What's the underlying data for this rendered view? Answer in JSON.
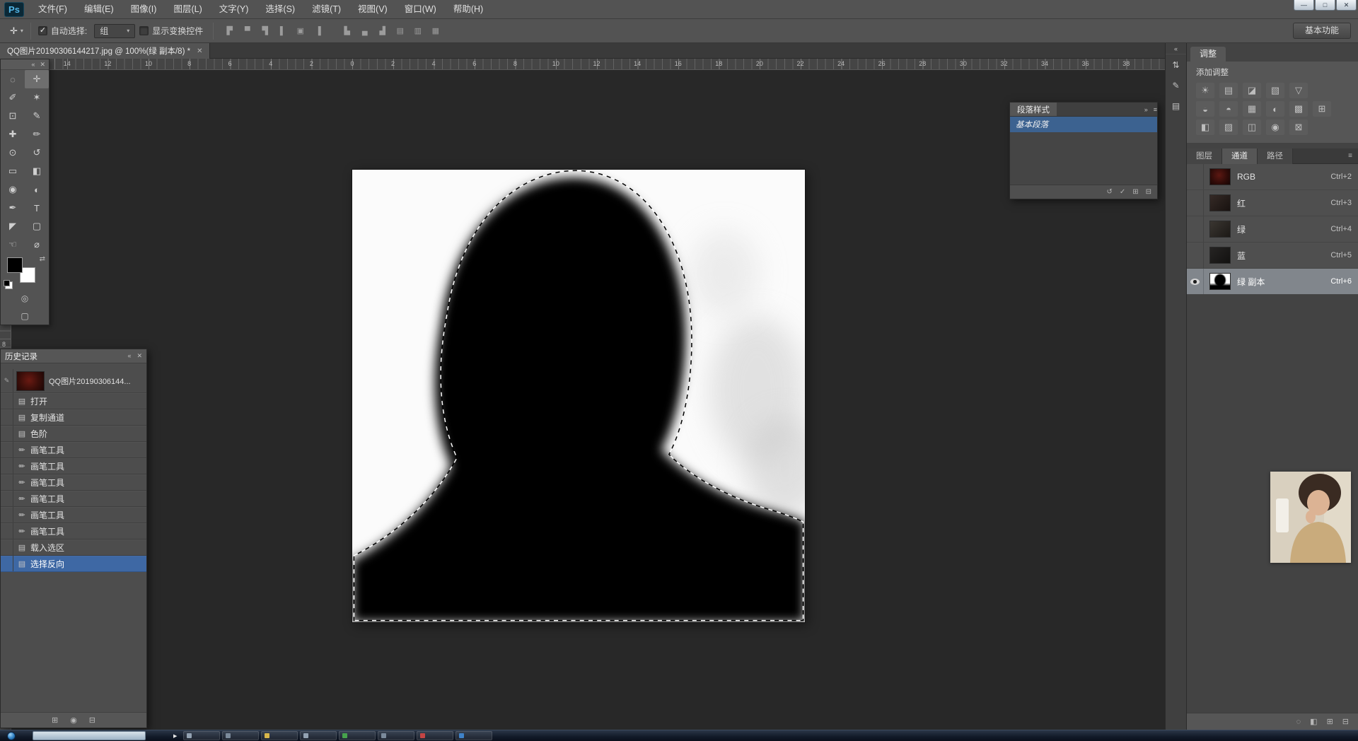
{
  "window": {
    "app": "Ps",
    "controls": [
      {
        "name": "minimize-button",
        "glyph": "—"
      },
      {
        "name": "maximize-button",
        "glyph": "□"
      },
      {
        "name": "close-button",
        "glyph": "✕"
      }
    ]
  },
  "menu_bar": {
    "items": [
      "文件(F)",
      "编辑(E)",
      "图像(I)",
      "图层(L)",
      "文字(Y)",
      "选择(S)",
      "滤镜(T)",
      "视图(V)",
      "窗口(W)",
      "帮助(H)"
    ]
  },
  "options_bar": {
    "tool_glyph": "✛",
    "tool_dropdown_arrow": "▾",
    "auto_select_label": "自动选择:",
    "auto_select_checked": true,
    "group_value": "组",
    "group_arrow": "▾",
    "show_transform_label": "显示变换控件",
    "show_transform_checked": false,
    "align_icons": [
      {
        "name": "align-top-edges-icon",
        "glyph": "▛"
      },
      {
        "name": "align-vertical-centers-icon",
        "glyph": "▀"
      },
      {
        "name": "align-bottom-edges-icon",
        "glyph": "▜"
      },
      {
        "name": "align-left-edges-icon",
        "glyph": "▌"
      },
      {
        "name": "align-horizontal-centers-icon",
        "glyph": "▣"
      },
      {
        "name": "align-right-edges-icon",
        "glyph": "▐"
      },
      {
        "name": "distribute-top-edges-icon",
        "glyph": "▙"
      },
      {
        "name": "distribute-vertical-centers-icon",
        "glyph": "▄"
      },
      {
        "name": "distribute-bottom-edges-icon",
        "glyph": "▟"
      },
      {
        "name": "distribute-left-edges-icon",
        "glyph": "▤"
      },
      {
        "name": "distribute-horizontal-centers-icon",
        "glyph": "▥"
      },
      {
        "name": "distribute-right-edges-icon",
        "glyph": "▦"
      }
    ],
    "workspace_label": "基本功能"
  },
  "document_tab": {
    "title": "QQ图片20190306144217.jpg @ 100%(绿 副本/8) *",
    "close_glyph": "✕"
  },
  "rulers": {
    "h_labels": [
      "14",
      "12",
      "10",
      "8",
      "6",
      "4",
      "2",
      "0",
      "2",
      "4",
      "6",
      "8",
      "10",
      "12",
      "14",
      "16",
      "18",
      "20",
      "22",
      "24",
      "26",
      "28",
      "30",
      "32",
      "34",
      "36",
      "38"
    ],
    "v_label": "8"
  },
  "tools_panel": {
    "collapse_glyph": "«",
    "close_glyph": "✕",
    "tools": [
      {
        "name": "elliptical-marquee-tool",
        "glyph": "◌"
      },
      {
        "name": "move-tool",
        "glyph": "✛",
        "selected": true
      },
      {
        "name": "lasso-tool",
        "glyph": "✐"
      },
      {
        "name": "magic-wand-tool",
        "glyph": "✶"
      },
      {
        "name": "crop-tool",
        "glyph": "⊡"
      },
      {
        "name": "eyedropper-tool",
        "glyph": "✎"
      },
      {
        "name": "healing-brush-tool",
        "glyph": "✚"
      },
      {
        "name": "brush-tool",
        "glyph": "✏"
      },
      {
        "name": "clone-stamp-tool",
        "glyph": "⊙"
      },
      {
        "name": "history-brush-tool",
        "glyph": "↺"
      },
      {
        "name": "eraser-tool",
        "glyph": "▭"
      },
      {
        "name": "gradient-tool",
        "glyph": "◧"
      },
      {
        "name": "blur-tool",
        "glyph": "◉"
      },
      {
        "name": "dodge-tool",
        "glyph": "◐"
      },
      {
        "name": "pen-tool",
        "glyph": "✒"
      },
      {
        "name": "type-tool",
        "glyph": "T"
      },
      {
        "name": "path-selection-tool",
        "glyph": "◤"
      },
      {
        "name": "rectangle-tool",
        "glyph": "▢"
      },
      {
        "name": "hand-tool",
        "glyph": "☜"
      },
      {
        "name": "zoom-tool",
        "glyph": "⌀"
      }
    ],
    "quick_mask_glyph": "◎",
    "screen_mode_glyph": "▢",
    "swap_glyph": "⇄"
  },
  "history_panel": {
    "title": "历史记录",
    "collapse_glyph": "«",
    "close_glyph": "✕",
    "snapshot_label": "QQ图片20190306144...",
    "snapshot_source_glyph": "✎",
    "items": [
      {
        "label": "打开",
        "icon": "▤"
      },
      {
        "label": "复制通道",
        "icon": "▤"
      },
      {
        "label": "色阶",
        "icon": "▤"
      },
      {
        "label": "画笔工具",
        "icon": "✏"
      },
      {
        "label": "画笔工具",
        "icon": "✏"
      },
      {
        "label": "画笔工具",
        "icon": "✏"
      },
      {
        "label": "画笔工具",
        "icon": "✏"
      },
      {
        "label": "画笔工具",
        "icon": "✏"
      },
      {
        "label": "画笔工具",
        "icon": "✏"
      },
      {
        "label": "载入选区",
        "icon": "▤"
      },
      {
        "label": "选择反向",
        "icon": "▤",
        "selected": true
      }
    ],
    "footer_icons": [
      {
        "name": "new-document-from-state-icon",
        "glyph": "⊞"
      },
      {
        "name": "new-snapshot-icon",
        "glyph": "◉"
      },
      {
        "name": "delete-state-icon",
        "glyph": "⊟"
      }
    ]
  },
  "paragraph_styles_panel": {
    "title": "段落样式",
    "expand_glyph": "»",
    "menu_glyph": "≡",
    "rows": [
      {
        "label": "基本段落",
        "selected": true
      }
    ],
    "footer_icons": [
      {
        "name": "clear-override-icon",
        "glyph": "↺"
      },
      {
        "name": "redefine-style-icon",
        "glyph": "✓"
      },
      {
        "name": "new-style-icon",
        "glyph": "⊞"
      },
      {
        "name": "delete-style-icon",
        "glyph": "⊟"
      }
    ]
  },
  "adjustments_panel": {
    "tab": "调整",
    "add_label": "添加调整",
    "icons_row1": [
      {
        "name": "brightness-contrast-icon",
        "glyph": "☀"
      },
      {
        "name": "levels-icon",
        "glyph": "▤"
      },
      {
        "name": "curves-icon",
        "glyph": "◪"
      },
      {
        "name": "exposure-icon",
        "glyph": "▧"
      },
      {
        "name": "vibrance-icon",
        "glyph": "▽"
      }
    ],
    "icons_row2": [
      {
        "name": "hue-saturation-icon",
        "glyph": "◒"
      },
      {
        "name": "color-balance-icon",
        "glyph": "◓"
      },
      {
        "name": "black-white-icon",
        "glyph": "▦"
      },
      {
        "name": "photo-filter-icon",
        "glyph": "◐"
      },
      {
        "name": "channel-mixer-icon",
        "glyph": "▩"
      },
      {
        "name": "color-lookup-icon",
        "glyph": "⊞"
      }
    ],
    "icons_row3": [
      {
        "name": "invert-icon",
        "glyph": "◧"
      },
      {
        "name": "posterize-icon",
        "glyph": "▨"
      },
      {
        "name": "threshold-icon",
        "glyph": "◫"
      },
      {
        "name": "gradient-map-icon",
        "glyph": "◉"
      },
      {
        "name": "selective-color-icon",
        "glyph": "⊠"
      }
    ]
  },
  "channels_panel": {
    "tabs": [
      {
        "label": "图层"
      },
      {
        "label": "通道",
        "active": true
      },
      {
        "label": "路径"
      }
    ],
    "menu_glyph": "≡",
    "rows": [
      {
        "name": "RGB",
        "shortcut": "Ctrl+2",
        "thumb": "thumb-rgb"
      },
      {
        "name": "红",
        "shortcut": "Ctrl+3",
        "thumb": "thumb-red"
      },
      {
        "name": "绿",
        "shortcut": "Ctrl+4",
        "thumb": "thumb-green"
      },
      {
        "name": "蓝",
        "shortcut": "Ctrl+5",
        "thumb": "thumb-blue"
      },
      {
        "name": "绿 副本",
        "shortcut": "Ctrl+6",
        "thumb": "thumb-mask",
        "eye": true,
        "selected": true
      }
    ],
    "footer_icons": [
      {
        "name": "load-channel-selection-icon",
        "glyph": "◌"
      },
      {
        "name": "save-selection-as-channel-icon",
        "glyph": "◧"
      },
      {
        "name": "new-channel-icon",
        "glyph": "⊞"
      },
      {
        "name": "delete-channel-icon",
        "glyph": "⊟"
      }
    ]
  },
  "dock_strip": {
    "collapse_glyph": "«",
    "icons": [
      {
        "name": "collapsed-panel-arrange-icon",
        "glyph": "⇅"
      },
      {
        "name": "collapsed-panel-brush-icon",
        "glyph": "✎"
      },
      {
        "name": "collapsed-panel-properties-icon",
        "glyph": "▤"
      }
    ]
  },
  "taskbar": {
    "overflow_glyph": "▶",
    "items": [
      {
        "name": "taskbar-app-active",
        "active": true
      },
      {
        "name": "taskbar-app-2",
        "dot": "#93a2b2"
      },
      {
        "name": "taskbar-app-3",
        "dot": "#7b8a9b"
      },
      {
        "name": "taskbar-app-4",
        "dot": "#d8b64a"
      },
      {
        "name": "taskbar-app-5",
        "dot": "#93a2b2"
      },
      {
        "name": "taskbar-app-6",
        "dot": "#46a24c"
      },
      {
        "name": "taskbar-app-7",
        "dot": "#7b8a9b"
      },
      {
        "name": "taskbar-app-8",
        "dot": "#c44444"
      },
      {
        "name": "taskbar-app-9",
        "dot": "#3f82c8"
      }
    ]
  },
  "colors": {
    "selection_blue": "#3e68a4",
    "chrome_gray": "#535353",
    "pasteboard": "#282828"
  }
}
